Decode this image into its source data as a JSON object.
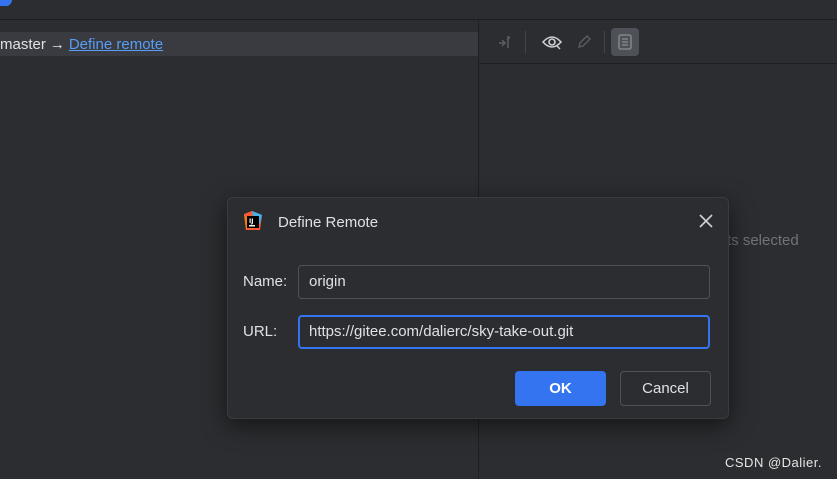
{
  "branch": {
    "name": "master",
    "arrow": "→",
    "define_remote_link": "Define remote"
  },
  "right_panel": {
    "empty_text": "ts selected",
    "toolbar_icons": [
      "merge-arrow-icon",
      "eye-icon",
      "pencil-icon",
      "document-icon"
    ]
  },
  "dialog": {
    "title": "Define Remote",
    "name_label": "Name:",
    "name_value": "origin",
    "url_label": "URL:",
    "url_value": "https://gitee.com/dalierc/sky-take-out.git",
    "ok_label": "OK",
    "cancel_label": "Cancel"
  },
  "watermark": "CSDN @Dalier.",
  "colors": {
    "background": "#2b2d30",
    "accent": "#3574f0",
    "link": "#589df6"
  }
}
